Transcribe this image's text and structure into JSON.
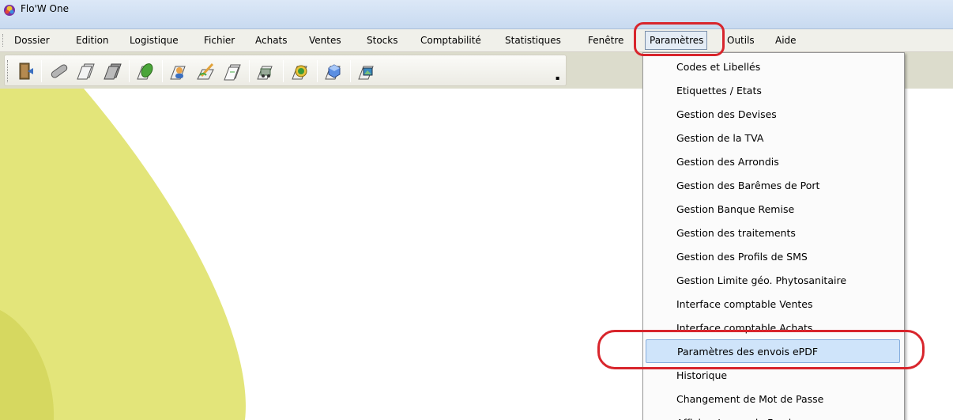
{
  "window": {
    "title": "Flo'W One"
  },
  "menubar": {
    "items": [
      {
        "label": "Dossier"
      },
      {
        "label": "Edition"
      },
      {
        "label": "Logistique"
      },
      {
        "label": "Fichier"
      },
      {
        "label": "Achats"
      },
      {
        "label": "Ventes"
      },
      {
        "label": "Stocks"
      },
      {
        "label": "Comptabilité"
      },
      {
        "label": "Statistiques"
      },
      {
        "label": "Fenêtre"
      },
      {
        "label": "Paramètres"
      },
      {
        "label": "Outils"
      },
      {
        "label": "Aide"
      }
    ]
  },
  "toolbar": {
    "buttons": [
      {
        "icon": "door-exit-icon"
      },
      {
        "icon": "pipe-tube-icon"
      },
      {
        "icon": "stack-sheets-icon"
      },
      {
        "icon": "stack-sheets-dark-icon"
      },
      {
        "icon": "leaf-icon"
      },
      {
        "icon": "person-card-icon"
      },
      {
        "icon": "pen-sign-icon"
      },
      {
        "icon": "document-stack-icon"
      },
      {
        "icon": "delivery-truck-icon"
      },
      {
        "icon": "euro-coin-icon"
      },
      {
        "icon": "blue-cube-icon"
      },
      {
        "icon": "image-view-icon"
      }
    ]
  },
  "params_menu": {
    "items": [
      {
        "label": "Codes et Libellés"
      },
      {
        "label": "Etiquettes / Etats"
      },
      {
        "label": "Gestion des Devises"
      },
      {
        "label": "Gestion de la TVA"
      },
      {
        "label": "Gestion des Arrondis"
      },
      {
        "label": "Gestion des Barêmes de Port"
      },
      {
        "label": "Gestion Banque Remise"
      },
      {
        "label": "Gestion des traitements"
      },
      {
        "label": "Gestion des Profils de SMS"
      },
      {
        "label": "Gestion Limite géo. Phytosanitaire"
      },
      {
        "label": "Interface comptable Ventes"
      },
      {
        "label": "Interface comptable Achats"
      },
      {
        "label": "Paramètres des envois ePDF",
        "highlighted": true
      },
      {
        "label": "Historique"
      },
      {
        "label": "Changement de Mot de Passe"
      },
      {
        "label": "Afficher Image de Fond"
      }
    ]
  },
  "colors": {
    "annotation": "#d8252c",
    "highlight": "#cfe4fa",
    "background_shape": "#e3e57a"
  }
}
